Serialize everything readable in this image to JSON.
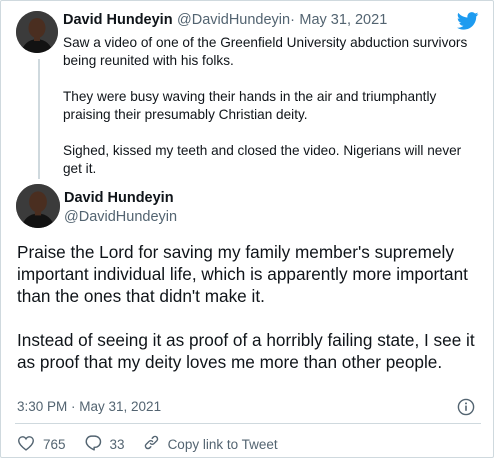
{
  "tweet1": {
    "author_name": "David Hundeyin",
    "author_handle": "@DavidHundeyin",
    "separator": "·",
    "date": "May 31, 2021",
    "paragraphs": [
      "Saw a video of one of the Greenfield University abduction survivors being reunited with his folks.",
      "They were busy waving their hands in the air and triumphantly praising their presumably Christian deity.",
      "Sighed, kissed my teeth and closed the video. Nigerians will never get it."
    ]
  },
  "tweet2": {
    "author_name": "David Hundeyin",
    "author_handle": "@DavidHundeyin",
    "paragraphs": [
      "Praise the Lord for saving my family member's supremely important individual life, which is apparently more important than the ones that didn't make it.",
      "Instead of seeing it as proof of a horribly failing state, I see it as proof that my deity loves me more than other people."
    ],
    "timestamp": "3:30 PM · May 31, 2021",
    "likes": "765",
    "replies": "33",
    "copy_link_label": "Copy link to Tweet"
  },
  "icons": {
    "brand": "twitter-bird-icon",
    "info": "info-icon",
    "like": "heart-icon",
    "reply": "reply-icon",
    "copy": "link-icon"
  },
  "colors": {
    "twitter_blue": "#1d9bf0",
    "secondary_text": "#536471",
    "border": "#cfd9de"
  }
}
